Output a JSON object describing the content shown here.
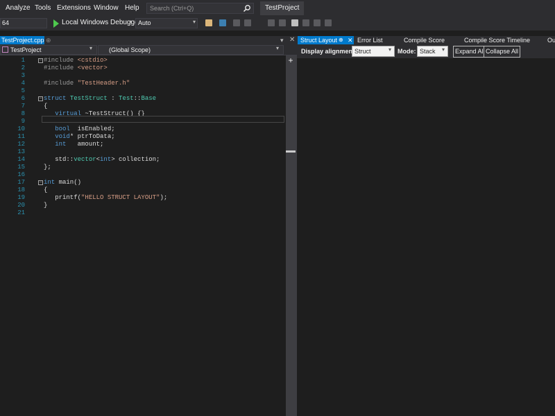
{
  "menubar": {
    "items": [
      "Analyze",
      "Tools",
      "Extensions",
      "Window",
      "Help"
    ],
    "search_placeholder": "Search (Ctrl+Q)",
    "project_title": "TestProject"
  },
  "toolbar": {
    "platform": "64",
    "run_label": "Local Windows Debugger",
    "dropdown_glyph": "▾",
    "config": "Auto"
  },
  "editor": {
    "file_tab": "TestProject.cpp",
    "file_tab_close": "⊕",
    "project_combo": "TestProject",
    "scope_combo": "(Global Scope)",
    "tabs_dropdown": "▾",
    "tabs_close": "✕",
    "split_button": "+",
    "line_numbers": [
      "1",
      "2",
      "3",
      "4",
      "5",
      "6",
      "7",
      "8",
      "9",
      "10",
      "11",
      "12",
      "13",
      "14",
      "15",
      "16",
      "17",
      "18",
      "19",
      "20",
      "21"
    ],
    "lines": [
      {
        "num": "1",
        "seg": [
          {
            "t": "#include ",
            "c": "pp"
          },
          {
            "t": "<cstdio>",
            "c": "str"
          }
        ]
      },
      {
        "num": "2",
        "seg": [
          {
            "t": "#include ",
            "c": "pp"
          },
          {
            "t": "<vector>",
            "c": "str"
          }
        ]
      },
      {
        "num": "3",
        "seg": []
      },
      {
        "num": "4",
        "seg": [
          {
            "t": "#include ",
            "c": "pp"
          },
          {
            "t": "\"TestHeader.h\"",
            "c": "str"
          }
        ]
      },
      {
        "num": "5",
        "seg": []
      },
      {
        "num": "6",
        "seg": [
          {
            "t": "struct ",
            "c": "kw"
          },
          {
            "t": "TestStruct",
            "c": "ty"
          },
          {
            "t": " : ",
            "c": ""
          },
          {
            "t": "Test",
            "c": "ty"
          },
          {
            "t": "::",
            "c": ""
          },
          {
            "t": "Base",
            "c": "ty"
          }
        ]
      },
      {
        "num": "7",
        "seg": [
          {
            "t": "{",
            "c": ""
          }
        ]
      },
      {
        "num": "8",
        "seg": [
          {
            "t": "   virtual ",
            "c": "kw"
          },
          {
            "t": "~TestStruct() {}",
            "c": ""
          }
        ]
      },
      {
        "num": "9",
        "seg": []
      },
      {
        "num": "10",
        "seg": [
          {
            "t": "   bool  ",
            "c": "kw"
          },
          {
            "t": "isEnabled;",
            "c": ""
          }
        ]
      },
      {
        "num": "11",
        "seg": [
          {
            "t": "   void",
            "c": "kw"
          },
          {
            "t": "* ptrToData;",
            "c": ""
          }
        ]
      },
      {
        "num": "12",
        "seg": [
          {
            "t": "   int   ",
            "c": "kw"
          },
          {
            "t": "amount;",
            "c": ""
          }
        ]
      },
      {
        "num": "13",
        "seg": []
      },
      {
        "num": "14",
        "seg": [
          {
            "t": "   std::",
            "c": ""
          },
          {
            "t": "vector",
            "c": "ty"
          },
          {
            "t": "<",
            "c": ""
          },
          {
            "t": "int",
            "c": "kw"
          },
          {
            "t": "> collection;",
            "c": ""
          }
        ]
      },
      {
        "num": "15",
        "seg": [
          {
            "t": "};",
            "c": ""
          }
        ]
      },
      {
        "num": "16",
        "seg": []
      },
      {
        "num": "17",
        "seg": [
          {
            "t": "int ",
            "c": "kw"
          },
          {
            "t": "main()",
            "c": ""
          }
        ]
      },
      {
        "num": "18",
        "seg": [
          {
            "t": "{",
            "c": ""
          }
        ]
      },
      {
        "num": "19",
        "seg": [
          {
            "t": "   printf(",
            "c": ""
          },
          {
            "t": "\"HELLO STRUCT LAYOUT\"",
            "c": "str"
          },
          {
            "t": ");",
            "c": ""
          }
        ]
      },
      {
        "num": "20",
        "seg": [
          {
            "t": "}",
            "c": ""
          }
        ]
      },
      {
        "num": "21",
        "seg": []
      }
    ]
  },
  "panel": {
    "tabs": [
      "Struct Layout",
      "Error List",
      "Compile Score",
      "Compile Score Timeline",
      "Ou"
    ],
    "pin_glyph": "⊕",
    "close_glyph": "✕",
    "alignment_label": "Display alignment:",
    "alignment_value": "Struct",
    "mode_label": "Mode:",
    "mode_value": "Stack",
    "expand_all": "Expand All",
    "collapse_all": "Collapse All"
  }
}
